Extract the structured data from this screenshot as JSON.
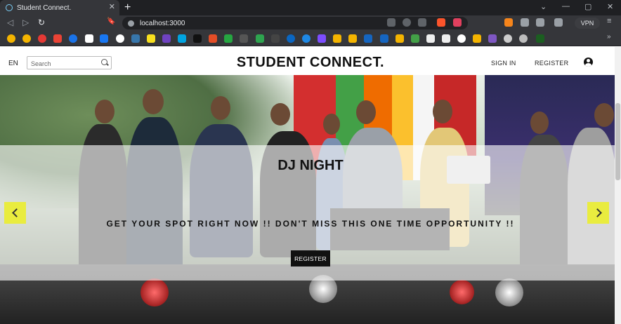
{
  "browser": {
    "tab_title": "Student Connect.",
    "tab_close": "✕",
    "new_tab": "+",
    "url": "localhost:3000",
    "vpn_label": "VPN",
    "window_controls": {
      "minimize": "—",
      "maximize": "▢",
      "close": "✕",
      "tab_search": "⌄"
    },
    "nav": {
      "back": "◁",
      "forward": "▷",
      "reload": "↻",
      "bookmark": "🔖"
    }
  },
  "header": {
    "lang": "EN",
    "search_placeholder": "Search",
    "brand": "STUDENT CONNECT.",
    "sign_in": "SIGN IN",
    "register": "REGISTER"
  },
  "hero": {
    "title": "DJ NIGHT",
    "subtitle": "GET YOUR SPOT RIGHT NOW !! DON'T MISS THIS ONE TIME OPPORTUNITY !!",
    "cta": "REGISTER"
  },
  "colors": {
    "accent_arrow": "#e9ec3f",
    "cta_bg": "#111111"
  }
}
